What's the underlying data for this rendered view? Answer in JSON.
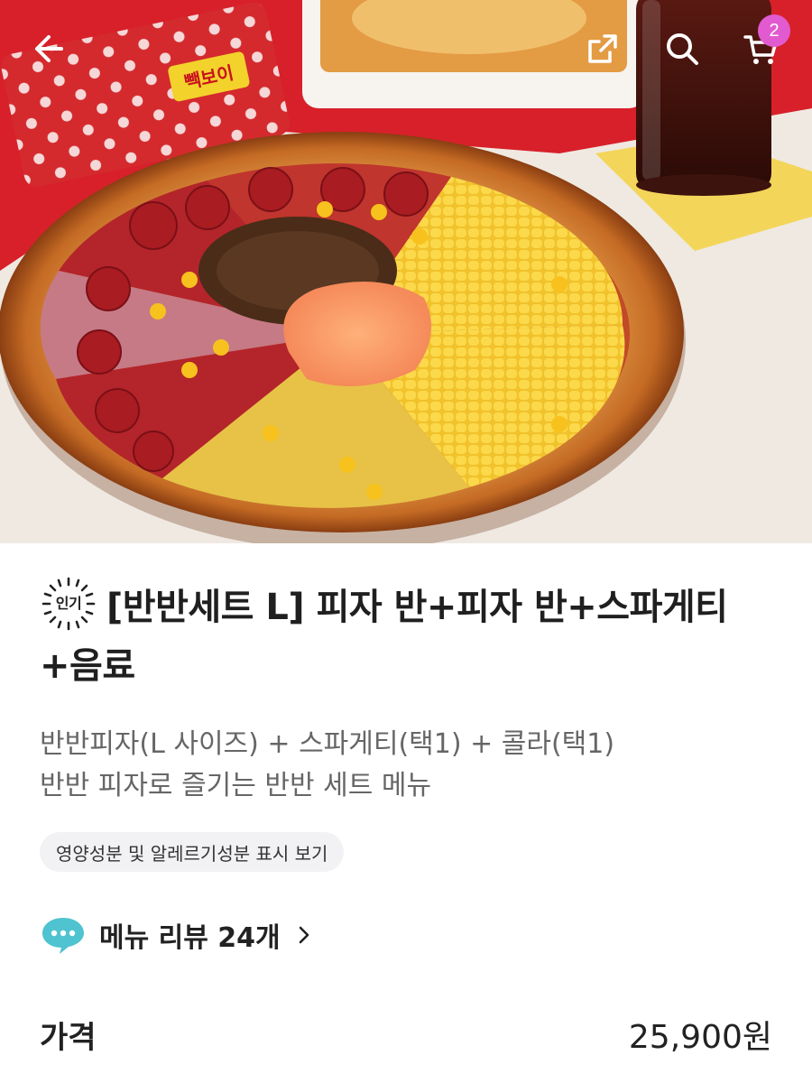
{
  "header": {
    "back_icon": "back-arrow-icon",
    "share_icon": "share-icon",
    "search_icon": "search-icon",
    "cart_icon": "cart-icon",
    "cart_count": "2"
  },
  "hero": {
    "logo_text": "빽보이"
  },
  "product": {
    "badge_label": "인기",
    "title": "[반반세트 L]  피자 반+피자 반+스파게티+음료",
    "desc_line1": "반반피자(L 사이즈) + 스파게티(택1) + 콜라(택1)",
    "desc_line2": "반반 피자로 즐기는 반반 세트 메뉴",
    "nutrition_label": "영양성분 및 알레르기성분 표시 보기",
    "review_label": "메뉴 리뷰 24개",
    "price_label": "가격",
    "price_value": "25,900원"
  },
  "colors": {
    "accent_badge": "#e25ad0",
    "review_bubble": "#4fc3cf",
    "tablecloth": "#d8202a"
  }
}
